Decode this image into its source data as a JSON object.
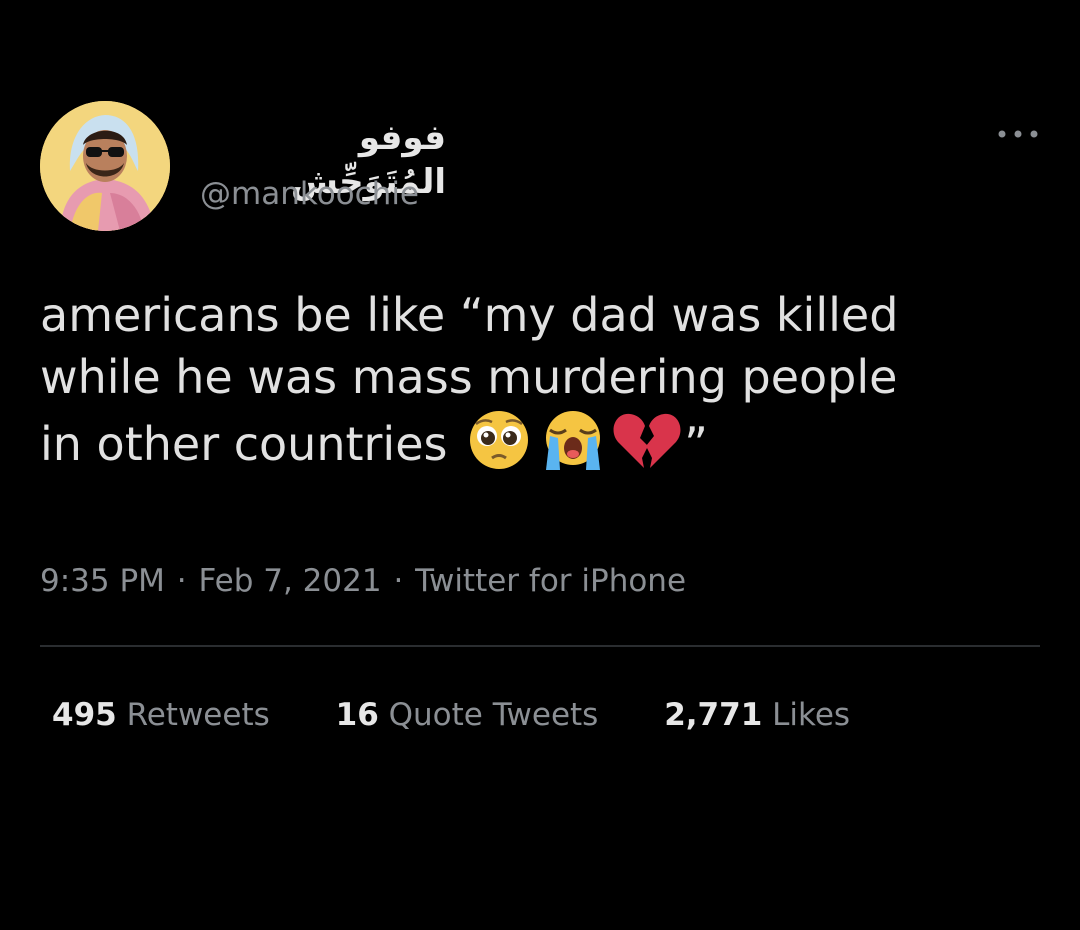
{
  "user": {
    "display_name": "فوفو المُتَوَحِّش",
    "handle": "@mankoochie",
    "avatar_icon": "user-avatar-photo"
  },
  "menu": {
    "icon": "more-dots-icon"
  },
  "tweet": {
    "line1": "americans be like “my dad was killed",
    "line2": "while he was mass murdering people",
    "line3": "in other countries",
    "closing_quote": "”",
    "emojis": [
      "pleading-face-emoji",
      "loudly-crying-face-emoji",
      "broken-heart-emoji"
    ]
  },
  "meta": {
    "time": "9:35 PM",
    "separator": "·",
    "date": "Feb 7, 2021",
    "source": "Twitter for iPhone"
  },
  "stats": {
    "retweets_count": "495",
    "retweets_label": "Retweets",
    "quotes_count": "16",
    "quotes_label": "Quote Tweets",
    "likes_count": "2,771",
    "likes_label": "Likes"
  },
  "colors": {
    "background": "#000000",
    "primary_text": "#e1e1e1",
    "secondary_text": "#8b8f94",
    "divider": "#2a2d30"
  }
}
